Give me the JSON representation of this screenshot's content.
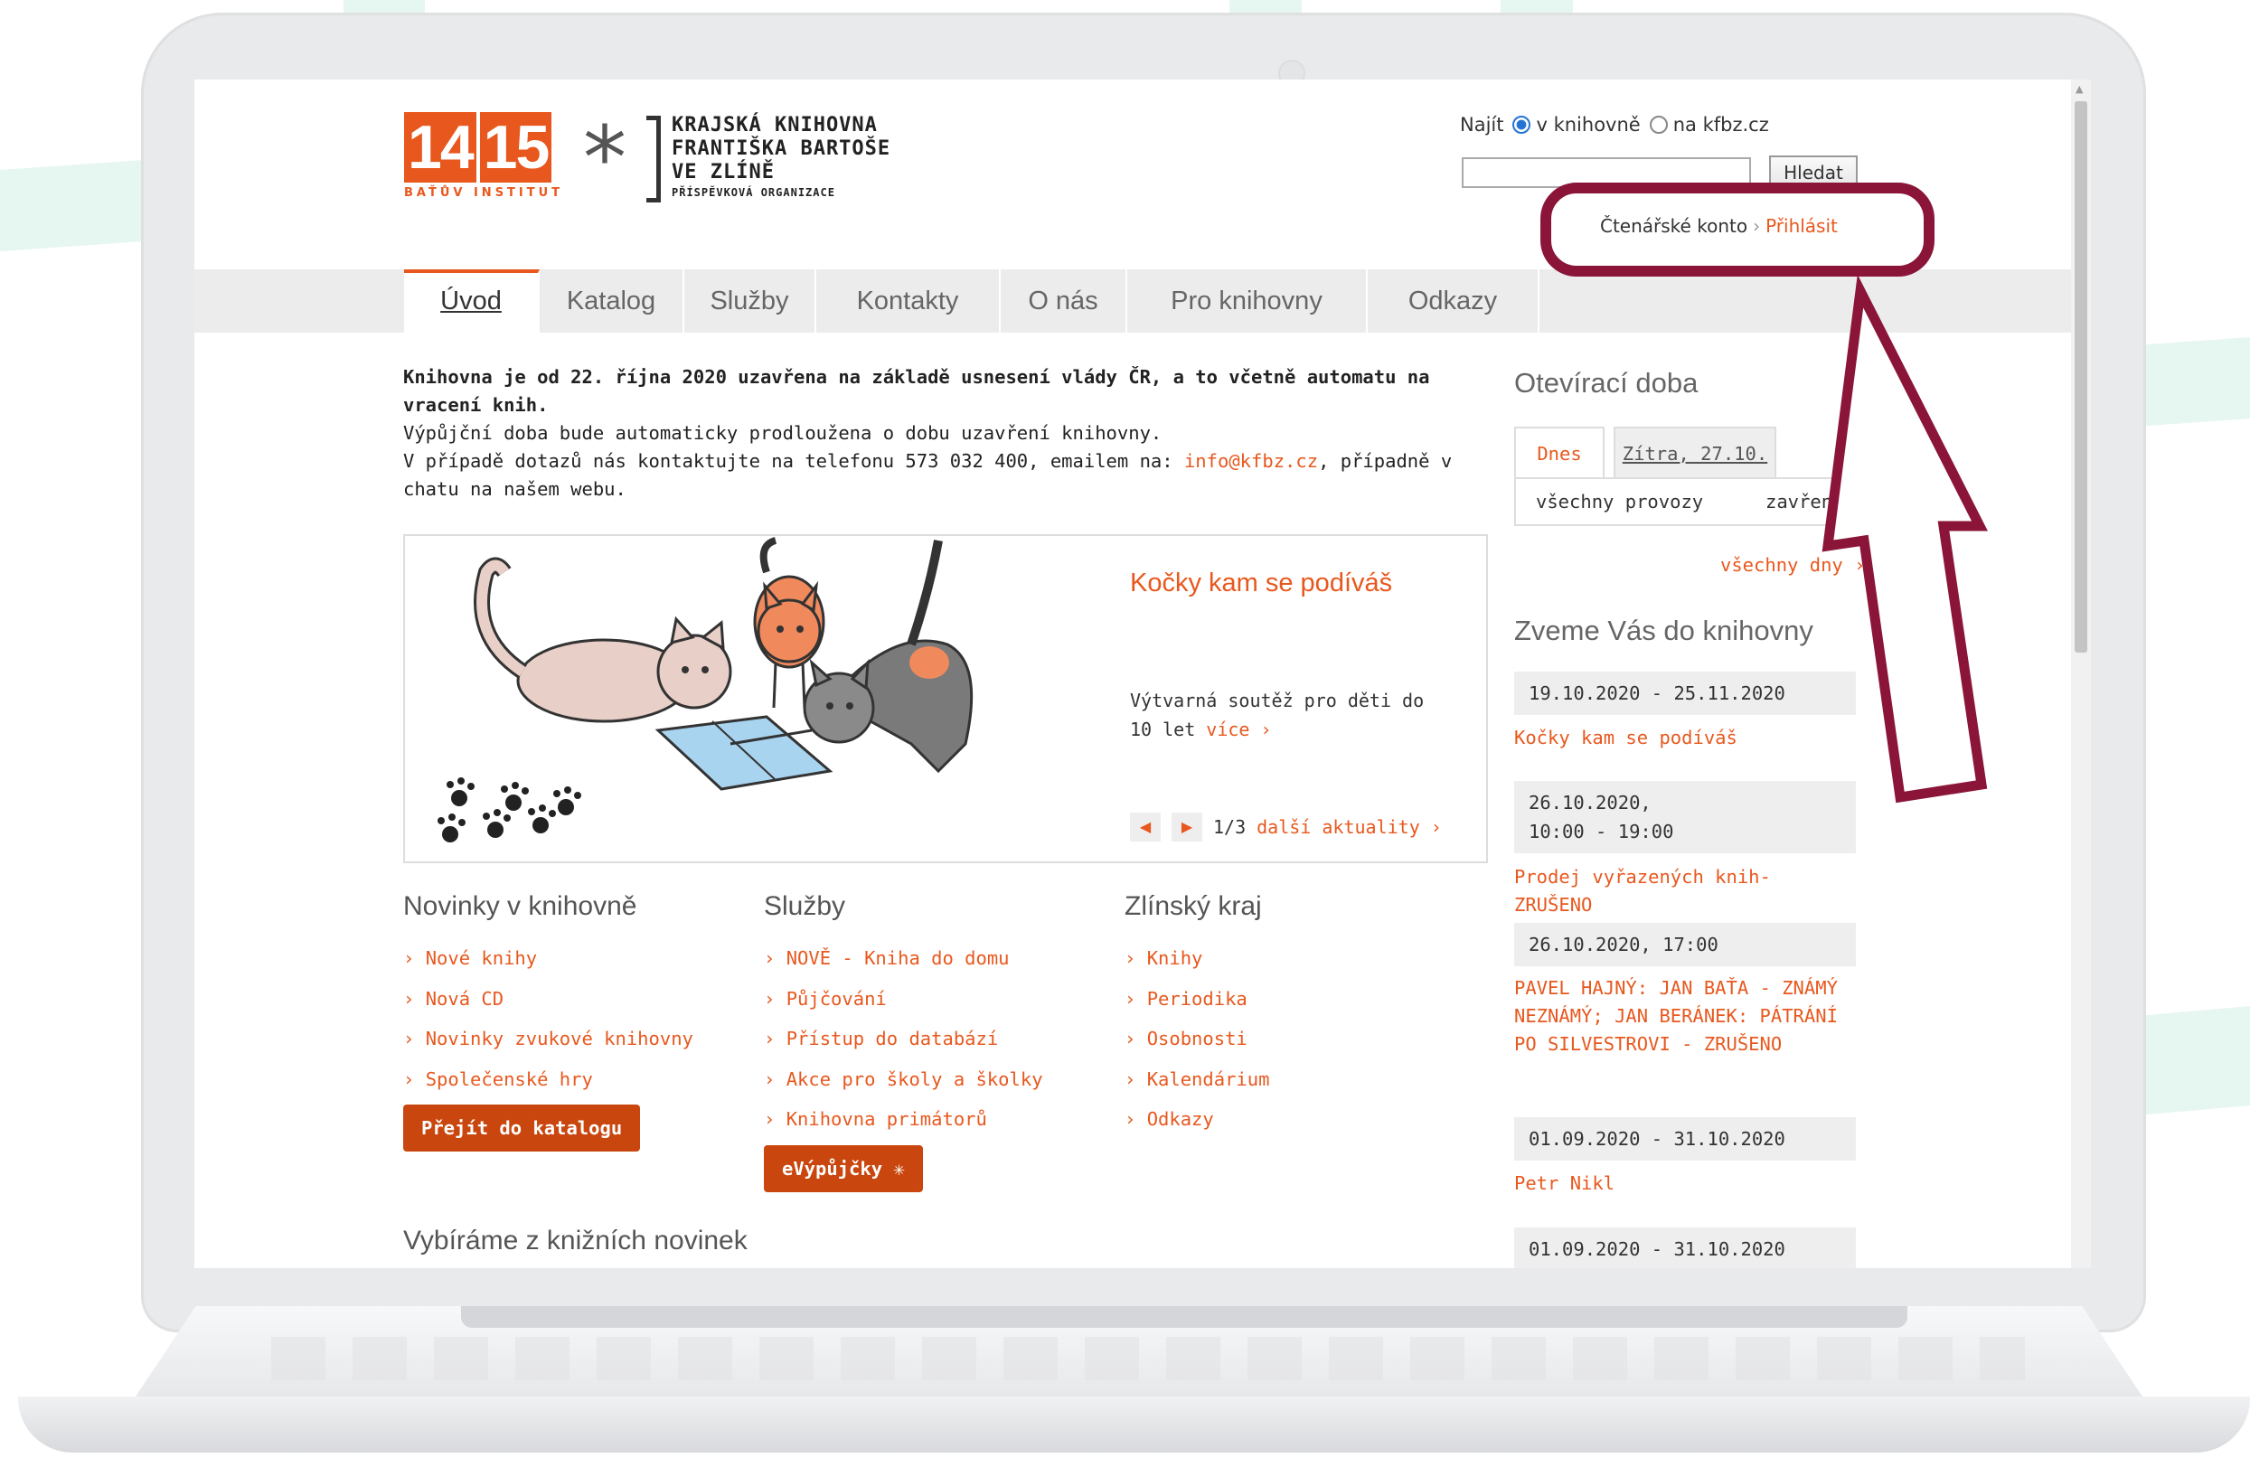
{
  "header": {
    "logo_numbers": [
      "14",
      "15"
    ],
    "logo_subtitle": "BAŤŮV INSTITUT",
    "library_name_lines": [
      "KRAJSKÁ KNIHOVNA",
      "FRANTIŠKA BARTOŠE",
      "VE ZLÍNĚ"
    ],
    "library_org": "PŘÍSPĚVKOVÁ ORGANIZACE",
    "search": {
      "label": "Najít",
      "option_library": "v knihovně",
      "option_web": "na kfbz.cz",
      "input_value": "",
      "button": "Hledat"
    },
    "account": {
      "label": "Čtenářské konto",
      "separator": "›",
      "login": "Přihlásit"
    }
  },
  "nav": {
    "tabs": [
      "Úvod",
      "Katalog",
      "Služby",
      "Kontakty",
      "O nás",
      "Pro knihovny",
      "Odkazy"
    ],
    "active": "Úvod"
  },
  "notice": {
    "bold": "Knihovna je od 22. října 2020 uzavřena na základě usnesení vlády ČR, a to včetně automatu na vracení knih.",
    "line1": "Výpůjční doba bude automaticky prodloužena o dobu uzavření knihovny.",
    "line2_before": "V případě dotazů nás kontaktujte na telefonu 573 032 400, emailem na: ",
    "line2_email": "info@kfbz.cz",
    "line2_after": ", případně v chatu na našem webu."
  },
  "slider": {
    "title": "Kočky kam se podíváš",
    "desc": "Výtvarná soutěž pro děti do 10 let",
    "more": "více ›",
    "counter": "1/3",
    "next_news": "další aktuality ›"
  },
  "columns": [
    {
      "title": "Novinky v knihovně",
      "items": [
        "Nové knihy",
        "Nová CD",
        "Novinky zvukové knihovny",
        "Společenské hry"
      ],
      "button": "Přejít do katalogu"
    },
    {
      "title": "Služby",
      "items": [
        "NOVĚ - Kniha do domu",
        "Půjčování",
        "Přístup do databází",
        "Akce pro školy a školky",
        "Knihovna primátorů"
      ],
      "button": "eVýpůjčky ✳"
    },
    {
      "title": "Zlínský kraj",
      "items": [
        "Knihy",
        "Periodika",
        "Osobnosti",
        "Kalendárium",
        "Odkazy"
      ],
      "button": ""
    }
  ],
  "section_title": "Vybíráme z knižních novinek",
  "sidebar": {
    "hours_title": "Otevírací doba",
    "tab_today": "Dnes",
    "tab_tomorrow": "Zítra, 27.10.",
    "row_label": "všechny provozy",
    "row_value": "zavřeno",
    "all_days": "všechny dny ›",
    "events_title": "Zveme Vás do knihovny",
    "events": [
      {
        "date": "19.10.2020 - 25.11.2020",
        "title": "Kočky kam se podíváš"
      },
      {
        "date": "26.10.2020,\n10:00 - 19:00",
        "title": "Prodej vyřazených knih- ZRUŠENO"
      },
      {
        "date": "26.10.2020, 17:00",
        "title": "PAVEL HAJNÝ: JAN BAŤA - ZNÁMÝ NEZNÁMÝ; JAN BERÁNEK: PÁTRÁNÍ PO SILVESTROVI - ZRUŠENO"
      },
      {
        "date": "01.09.2020 - 31.10.2020",
        "title": "Petr Nikl"
      },
      {
        "date": "01.09.2020 - 31.10.2020",
        "title": ""
      }
    ]
  },
  "colors": {
    "accent": "#e8581e",
    "button": "#c9470e",
    "annotation": "#8a1538",
    "mint": "#e6f6f1"
  },
  "icons": [
    "radio-icon",
    "prev-arrow-icon",
    "next-arrow-icon",
    "scroll-up-icon",
    "star-logo-icon"
  ]
}
